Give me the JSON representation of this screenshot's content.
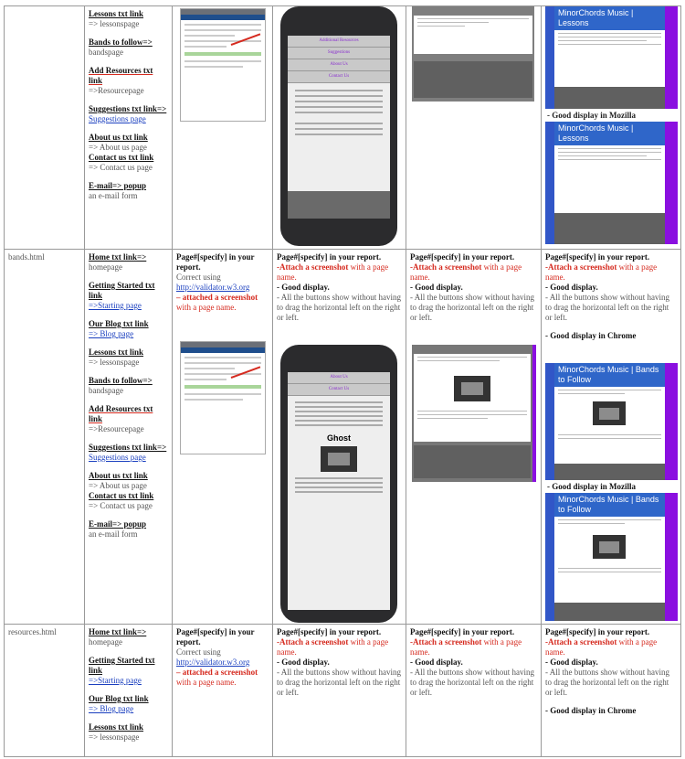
{
  "rows": [
    {
      "file": "",
      "links": [
        {
          "label": "Lessons txt link",
          "target": "=> lessonspage",
          "style": "plain"
        },
        {
          "label": "Bands to follow=>",
          "target": "bandspage",
          "style": "plain"
        },
        {
          "label": "Add Resources txt link",
          "target": "=>Resourcepage",
          "style": "red"
        },
        {
          "label": "Suggestions txt link=>",
          "target": "Suggestions page",
          "style": "link"
        },
        {
          "label": "About us txt link",
          "target": "=> About us page",
          "style": "plain-tight"
        },
        {
          "label": "Contact us txt link",
          "target": "=> Contact us page",
          "style": "plain"
        },
        {
          "label": "E-mail=> popup",
          "target": "an e-mail form",
          "style": "plain"
        }
      ],
      "col6_captions": [
        "- Good display in Mozilla"
      ],
      "mc_titles": [
        "MinorChords Music | Lessons",
        "MinorChords Music | Lessons"
      ]
    },
    {
      "file": "bands.html",
      "links": [
        {
          "label": "Home txt link=>",
          "target": "homepage",
          "style": "plain"
        },
        {
          "label": "Getting Started txt link",
          "target": "=>Starting page",
          "style": "link"
        },
        {
          "label": "Our Blog txt link",
          "target": "=> Blog page",
          "style": "link"
        },
        {
          "label": "Lessons txt link",
          "target": "=> lessonspage",
          "style": "plain"
        },
        {
          "label": "Bands to follow=>",
          "target": "bandspage",
          "style": "plain"
        },
        {
          "label": "Add Resources txt link",
          "target": "=>Resourcepage",
          "style": "red"
        },
        {
          "label": "Suggestions txt link=>",
          "target": "Suggestions page",
          "style": "link"
        },
        {
          "label": "About us txt link",
          "target": "=> About us page",
          "style": "plain-tight"
        },
        {
          "label": "Contact us txt link",
          "target": "=> Contact us page",
          "style": "plain"
        },
        {
          "label": "E-mail=> popup",
          "target": "an e-mail form",
          "style": "plain"
        }
      ],
      "validator": {
        "head": "Page#[specify] in your report.",
        "correct": "Correct using",
        "url": "http://validator.w3.org",
        "attached": " – attached a screenshot",
        "rest": " with a page name."
      },
      "mobile": {
        "head": "Page#[specify] in your report.",
        "attach": "-Attach a screenshot",
        "rest": " with a page name.",
        "good": "- Good display.",
        "note": "- All the buttons show without having to drag the horizontal left on the right or left."
      },
      "tablet": {
        "head": "Page#[specify] in your report.",
        "attach": "-Attach a screenshot",
        "rest": " with a page name.",
        "good": "- Good display.",
        "note": "- All the buttons show without having to drag the horizontal left on the right or left."
      },
      "desktop": {
        "head": "Page#[specify] in your report.",
        "attach": "-Attach a screenshot",
        "rest": " with a page name.",
        "good": "- Good display.",
        "note": "- All the buttons show without having to drag the horizontal left on the right or left.",
        "chrome": "- Good display in Chrome",
        "mozilla": "- Good display in Mozilla"
      },
      "mc_titles": [
        "MinorChords Music | Bands to Follow",
        "MinorChords Music | Bands to Follow"
      ],
      "phone_nav": [
        "About Us",
        "Contact Us"
      ],
      "phone_heading": "Ghost"
    },
    {
      "file": "resources.html",
      "links": [
        {
          "label": "Home txt link=>",
          "target": "homepage",
          "style": "plain"
        },
        {
          "label": "Getting Started txt link",
          "target": "=>Starting page",
          "style": "link"
        },
        {
          "label": "Our Blog txt link",
          "target": "=> Blog page",
          "style": "link"
        },
        {
          "label": "Lessons txt link",
          "target": "=> lessonspage",
          "style": "plain"
        }
      ],
      "validator": {
        "head": "Page#[specify] in your report.",
        "correct": "Correct using",
        "url": "http://validator.w3.org",
        "attached": " – attached a screenshot",
        "rest": " with a page name."
      },
      "mobile": {
        "head": "Page#[specify] in your report.",
        "attach": "-Attach a screenshot",
        "rest": " with a page name.",
        "good": "- Good display.",
        "note": "- All the buttons show without having to drag the horizontal left on the right or left."
      },
      "tablet": {
        "head": "Page#[specify] in your report.",
        "attach": "-Attach a screenshot",
        "rest": " with a page name.",
        "good": "- Good display.",
        "note": "- All the buttons show without having to drag the horizontal left on the right or left."
      },
      "desktop": {
        "head": "Page#[specify] in your report.",
        "attach": "-Attach a screenshot",
        "rest": " with a page name.",
        "good": "- Good display.",
        "note": "- All the buttons show without having to drag the horizontal left on the right or left.",
        "chrome": "- Good display in Chrome"
      }
    }
  ],
  "top_phone_nav": [
    "Additional Resources",
    "Suggestions",
    "About Us",
    "Contact Us"
  ]
}
